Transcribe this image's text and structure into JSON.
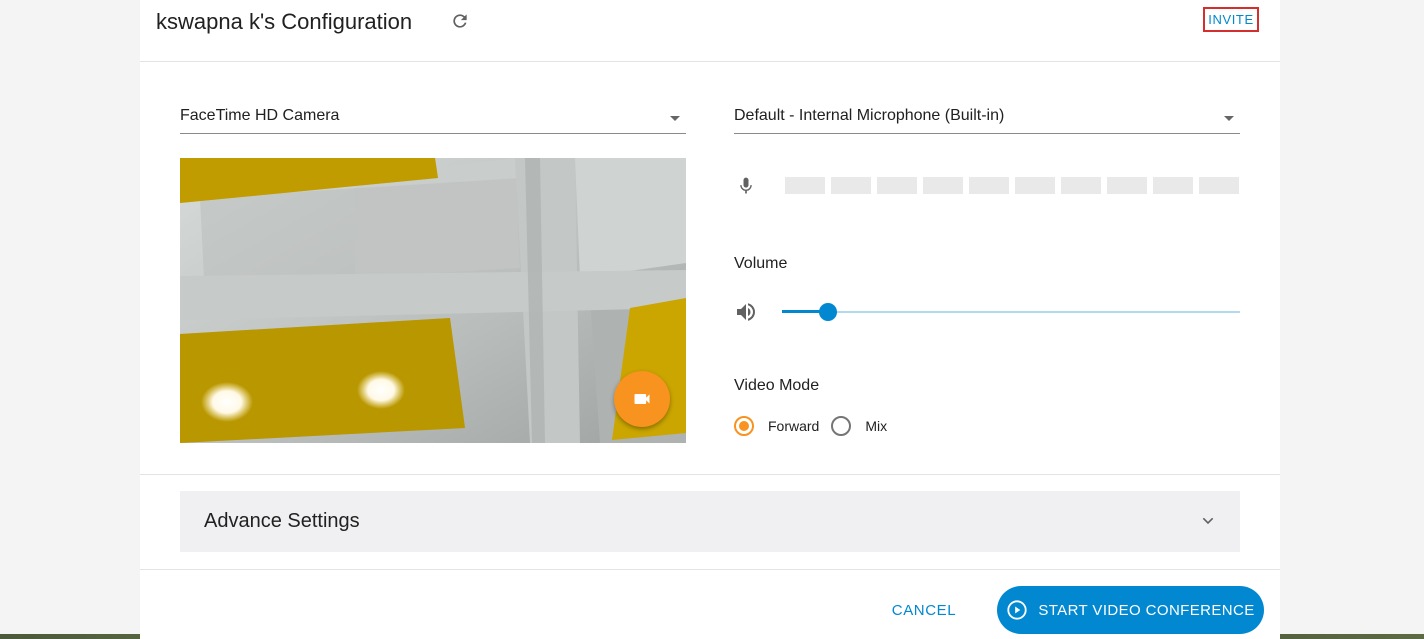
{
  "header": {
    "title": "kswapna k's Configuration",
    "refresh_icon": "refresh-icon",
    "invite_label": "INVITE"
  },
  "camera": {
    "selected": "FaceTime HD Camera",
    "preview_icon": "videocam-icon"
  },
  "microphone": {
    "selected": "Default - Internal Microphone (Built-in)",
    "icon": "mic-icon",
    "meter_active_bars": 0,
    "meter_total_bars": 10
  },
  "volume": {
    "label": "Volume",
    "icon": "speaker-icon",
    "level_percent": 10
  },
  "video_mode": {
    "label": "Video Mode",
    "options": [
      {
        "label": "Forward",
        "selected": true
      },
      {
        "label": "Mix",
        "selected": false
      }
    ]
  },
  "advance_settings": {
    "label": "Advance Settings",
    "expanded": false
  },
  "footer": {
    "cancel_label": "CANCEL",
    "start_label": "START VIDEO CONFERENCE"
  },
  "colors": {
    "accent_blue": "#0288d1",
    "accent_orange": "#f7931e",
    "invite_border": "#d32f2f"
  }
}
